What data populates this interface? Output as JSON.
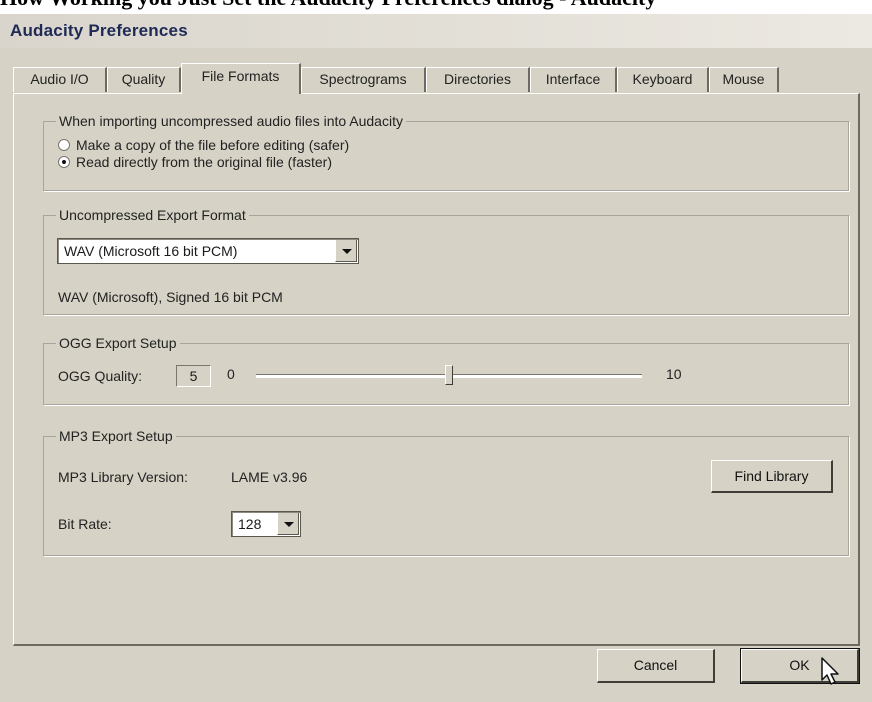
{
  "caption": "How Working you Just Set the Audacity Preferences dialog - Audacity",
  "window": {
    "title": "Audacity Preferences"
  },
  "tabs": [
    {
      "label": "Audio I/O"
    },
    {
      "label": "Quality"
    },
    {
      "label": "File Formats"
    },
    {
      "label": "Spectrograms"
    },
    {
      "label": "Directories"
    },
    {
      "label": "Interface"
    },
    {
      "label": "Keyboard"
    },
    {
      "label": "Mouse"
    }
  ],
  "active_tab": "File Formats",
  "import_group": {
    "title": "When importing uncompressed audio files into Audacity",
    "options": [
      {
        "label": "Make a copy of the file before editing (safer)",
        "selected": false
      },
      {
        "label": "Read directly from the original file (faster)",
        "selected": true
      }
    ]
  },
  "export_group": {
    "title": "Uncompressed Export Format",
    "format_value": "WAV (Microsoft 16 bit PCM)",
    "format_description": "WAV (Microsoft), Signed 16 bit PCM"
  },
  "ogg_group": {
    "title": "OGG Export Setup",
    "quality_label": "OGG Quality:",
    "quality_value": "5",
    "min_label": "0",
    "max_label": "10",
    "slider_value": 5,
    "slider_min": 0,
    "slider_max": 10
  },
  "mp3_group": {
    "title": "MP3 Export Setup",
    "library_label": "MP3 Library Version:",
    "library_version": "LAME v3.96",
    "find_library_button": "Find Library",
    "bitrate_label": "Bit Rate:",
    "bitrate_value": "128"
  },
  "buttons": {
    "cancel": "Cancel",
    "ok": "OK"
  }
}
